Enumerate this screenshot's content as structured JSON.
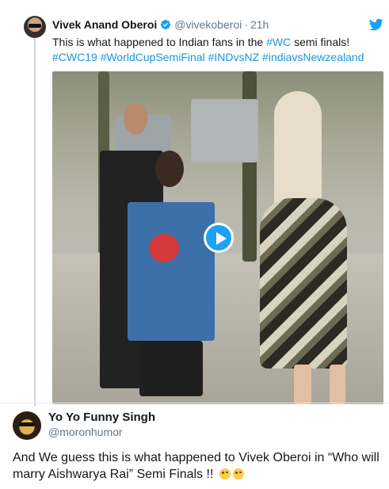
{
  "quoted_tweet": {
    "author_name": "Vivek Anand Oberoi",
    "handle": "@vivekoberoi",
    "separator": "·",
    "time": "21h",
    "text": "This is what happened to Indian fans in the ",
    "inline_hashtag": "#WC",
    "text_after": " semi finals!",
    "hashtags": [
      "#CWC19",
      "#WorldCupSemiFinal",
      "#INDvsNZ",
      "#indiavsNewzealand"
    ],
    "icons": {
      "verified": "verified-badge-icon",
      "platform": "twitter-bird-icon",
      "media": "play-icon"
    },
    "colors": {
      "link": "#1b95e0",
      "accent": "#1da1f2",
      "muted": "#657786"
    }
  },
  "reply_tweet": {
    "author_name": "Yo Yo Funny Singh",
    "handle": "@moronhumor",
    "text": "And We guess this is what happened to Vivek Oberoi in “Who will marry Aishwarya Rai” Semi Finals !!"
  }
}
